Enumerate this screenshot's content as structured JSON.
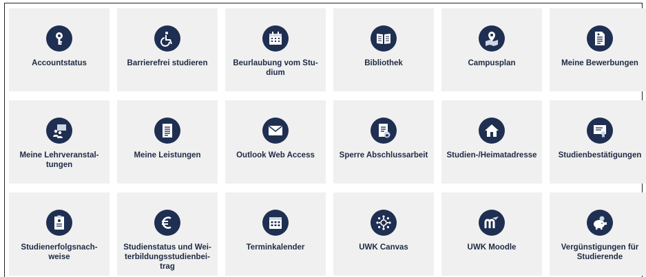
{
  "colors": {
    "tile_bg": "#f0f0f0",
    "icon_bg": "#1f2f52",
    "label": "#1e2a44"
  },
  "tiles": [
    {
      "label": "Accountstatus",
      "icon": "key-icon"
    },
    {
      "label": "Barrierefrei studieren",
      "icon": "wheelchair-icon"
    },
    {
      "label": "Beurlaubung vom Stu-\ndium",
      "icon": "calendar-icon"
    },
    {
      "label": "Bibliothek",
      "icon": "book-icon"
    },
    {
      "label": "Campusplan",
      "icon": "map-pin-icon"
    },
    {
      "label": "Meine Bewerbungen",
      "icon": "document-icon"
    },
    {
      "label": "Meine Lehrveranstal-\ntungen",
      "icon": "people-board-icon"
    },
    {
      "label": "Meine Leistungen",
      "icon": "list-document-icon"
    },
    {
      "label": "Outlook Web Access",
      "icon": "envelope-icon"
    },
    {
      "label": "Sperre Abschlussarbeit",
      "icon": "locked-document-icon"
    },
    {
      "label": "Studien-/Heimatadresse",
      "icon": "house-icon"
    },
    {
      "label": "Studienbestätigungen",
      "icon": "certificate-icon"
    },
    {
      "label": "Studienerfolgsnach-\nweise",
      "icon": "clipboard-icon"
    },
    {
      "label": "Studienstatus und Wei-\nterbildungsstudienbei-\ntrag",
      "icon": "euro-icon"
    },
    {
      "label": "Terminkalender",
      "icon": "calendar-grid-icon"
    },
    {
      "label": "UWK Canvas",
      "icon": "canvas-icon"
    },
    {
      "label": "UWK Moodle",
      "icon": "moodle-icon"
    },
    {
      "label": "Vergünstigungen für\nStudierende",
      "icon": "piggy-bank-icon"
    }
  ]
}
